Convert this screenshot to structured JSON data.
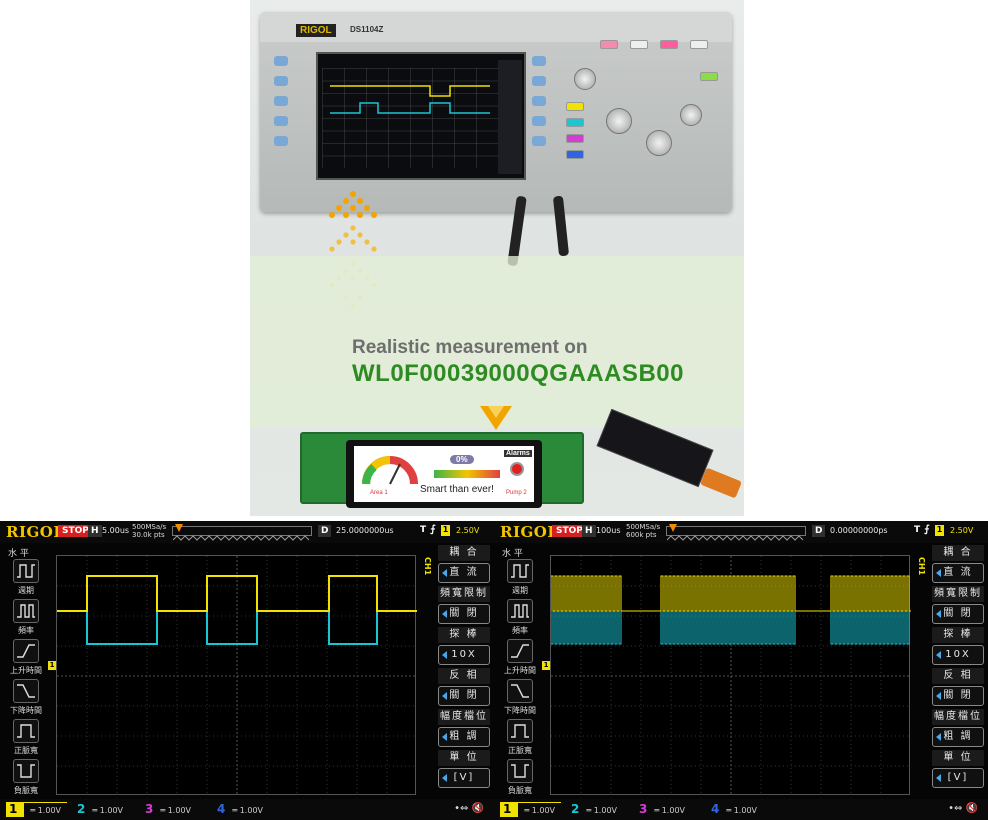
{
  "photo": {
    "scope_brand": "RIGOL",
    "scope_model": "DS1104Z",
    "caption_line1": "Realistic measurement on",
    "caption_line2": "WL0F00039000QGAAASB00",
    "lcd_text": "Smart than ever!",
    "lcd_alarms": "Alarms",
    "lcd_percent": "0%",
    "lcd_area": "Area 1",
    "lcd_pump": "Pump 2",
    "caption_color": "#2e8b22"
  },
  "screens": [
    {
      "logo": "RIGOL",
      "status": "STOP",
      "h_label": "H",
      "timebase": "5.00us",
      "sample_rate": "500MSa/s",
      "points": "30.0k pts",
      "d_label": "D",
      "delay": "25.0000000us",
      "trigger_label": "T",
      "trigger_channel": "1",
      "trigger_level": "2.50V",
      "side_tag": "CH1",
      "left_title": "水 平",
      "left_items": [
        "週期",
        "頻率",
        "上升時間",
        "下降時間",
        "正脈寬",
        "負脈寬"
      ],
      "right_menu": [
        {
          "title": "耦 合",
          "value": "直 流"
        },
        {
          "title": "頻寬限制",
          "value": "關 閉"
        },
        {
          "title": "探 棒",
          "value": "10X"
        },
        {
          "title": "反 相",
          "value": "關 閉"
        },
        {
          "title": "幅度檔位",
          "value": "粗 調"
        },
        {
          "title": "單 位",
          "value": "[V]"
        }
      ],
      "channels": [
        {
          "num": "1",
          "scale": "1.00V",
          "color": "#f2e200"
        },
        {
          "num": "2",
          "scale": "1.00V",
          "color": "#19c6d6"
        },
        {
          "num": "3",
          "scale": "1.00V",
          "color": "#d13fd1"
        },
        {
          "num": "4",
          "scale": "1.00V",
          "color": "#2f66e0"
        }
      ],
      "bottom_icons": "•⇔ 🔇",
      "waveform": "slow"
    },
    {
      "logo": "RIGOL",
      "status": "STOP",
      "h_label": "H",
      "timebase": "100us",
      "sample_rate": "500MSa/s",
      "points": "600k pts",
      "d_label": "D",
      "delay": "0.00000000ps",
      "trigger_label": "T",
      "trigger_channel": "1",
      "trigger_level": "2.50V",
      "side_tag": "CH1",
      "left_title": "水 平",
      "left_items": [
        "週期",
        "頻率",
        "上升時間",
        "下降時間",
        "正脈寬",
        "負脈寬"
      ],
      "right_menu": [
        {
          "title": "耦 合",
          "value": "直 流"
        },
        {
          "title": "頻寬限制",
          "value": "關 閉"
        },
        {
          "title": "探 棒",
          "value": "10X"
        },
        {
          "title": "反 相",
          "value": "關 閉"
        },
        {
          "title": "幅度檔位",
          "value": "粗 調"
        },
        {
          "title": "單 位",
          "value": "[V]"
        }
      ],
      "channels": [
        {
          "num": "1",
          "scale": "1.00V",
          "color": "#f2e200"
        },
        {
          "num": "2",
          "scale": "1.00V",
          "color": "#19c6d6"
        },
        {
          "num": "3",
          "scale": "1.00V",
          "color": "#d13fd1"
        },
        {
          "num": "4",
          "scale": "1.00V",
          "color": "#2f66e0"
        }
      ],
      "bottom_icons": "•⇔ 🔇",
      "waveform": "burst"
    }
  ]
}
